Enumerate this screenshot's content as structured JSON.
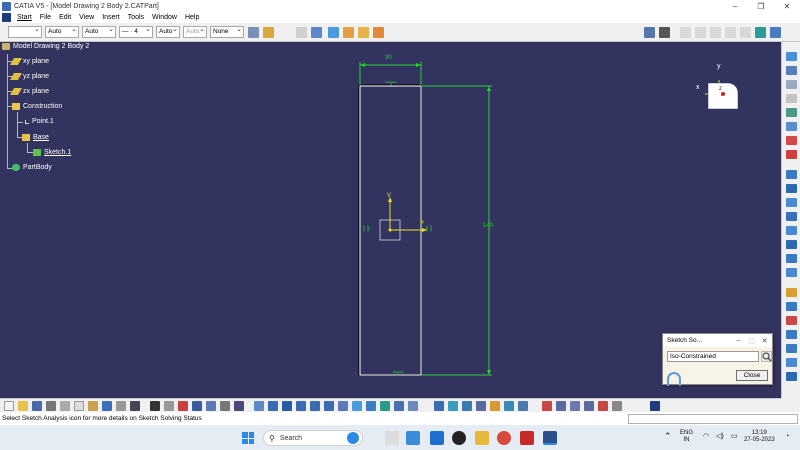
{
  "window": {
    "title": "CATIA V5 - [Model Drawing 2 Body 2.CATPart]",
    "controls": [
      "–",
      "❐",
      "✕"
    ]
  },
  "menu": [
    "Start",
    "File",
    "Edit",
    "View",
    "Insert",
    "Tools",
    "Window",
    "Help"
  ],
  "toolbar": {
    "combos": [
      "",
      "Auto",
      "Auto",
      "— · 4",
      "Auto",
      "Auto",
      "None"
    ]
  },
  "tree": {
    "root": "Model Drawing 2 Body 2",
    "xy": "xy plane",
    "yz": "yz plane",
    "zx": "zx plane",
    "construction": "Construction",
    "point": "Point.1",
    "base": "Base",
    "sketch": "Sketch.1",
    "partbody": "PartBody"
  },
  "sketch": {
    "width_dim": "30",
    "height_dim": "140",
    "axis_y": "V",
    "axis_h": "H"
  },
  "compass": {
    "x": "x",
    "y": "y",
    "z": "z"
  },
  "dialog": {
    "title": "Sketch So...",
    "status": "Iso-Constrained",
    "close_label": "Close",
    "min": "–",
    "max": "▢",
    "x": "✕"
  },
  "status_bar": {
    "message": "Select Sketch Analysis icon for more details on Sketch Solving Status"
  },
  "taskbar": {
    "search": "Search",
    "lang1": "ENG",
    "lang2": "IN",
    "time": "13:19",
    "date": "27-05-2023"
  },
  "colors": {
    "viewport": "#33335f",
    "sketch_white": "#ffffff",
    "constraint_green": "#27d22b",
    "axis_yellow": "#e8e02a"
  }
}
